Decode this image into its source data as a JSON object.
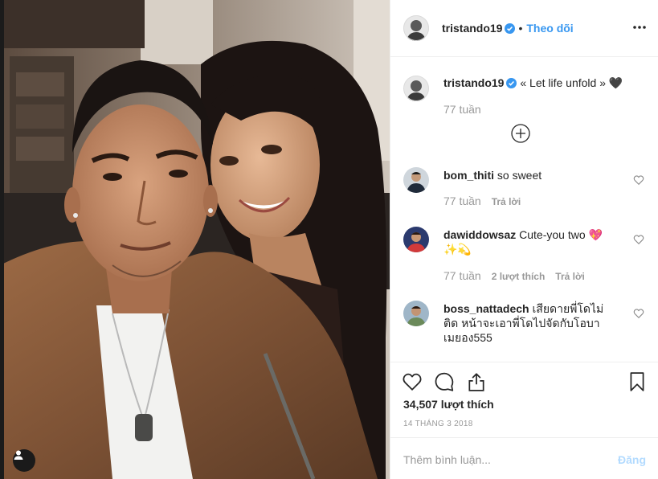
{
  "post": {
    "author": "tristando19",
    "follow_label": "Theo dõi",
    "dot": "•"
  },
  "caption": {
    "author": "tristando19",
    "text": "« Let life unfold » 🖤",
    "time": "77 tuần"
  },
  "comments": [
    {
      "user": "bom_thiti",
      "text": "so sweet",
      "time": "77 tuần",
      "likes": "",
      "reply": "Trả lời"
    },
    {
      "user": "dawiddowsaz",
      "text": "Cute-you two 💖 ✨💫",
      "time": "77 tuần",
      "likes": "2 lượt thích",
      "reply": "Trả lời"
    },
    {
      "user": "boss_nattadech",
      "text": "เสียดายพี่โดไม่ติด หน้าจะเอาพี่โดไปจัดกับโอบาเมยอง555",
      "time": "",
      "likes": "",
      "reply": ""
    }
  ],
  "stats": {
    "likes": "34,507 lượt thích",
    "date": "14 THÁNG 3 2018"
  },
  "composer": {
    "placeholder": "Thêm bình luận...",
    "post_label": "Đăng"
  },
  "colors": {
    "accent": "#3897f0",
    "muted": "#999999",
    "border": "#efefef",
    "post_disabled": "#b3dbff"
  },
  "icons": {
    "verified": "verified-badge-icon",
    "more": "more-options-icon",
    "load_more": "plus-circle-icon",
    "like": "heart-icon",
    "comment": "comment-bubble-icon",
    "share": "share-icon",
    "save": "bookmark-icon",
    "tag": "user-tag-icon"
  }
}
